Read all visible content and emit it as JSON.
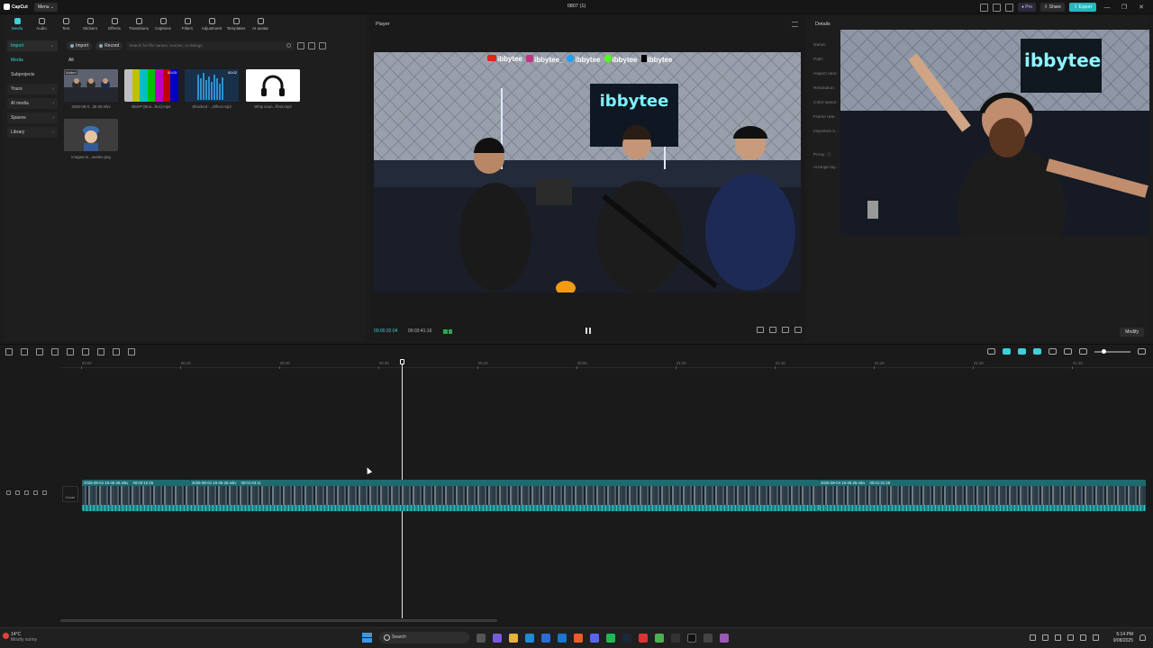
{
  "app": {
    "logo_label": "CapCut",
    "menu_label": "Menu",
    "doc_title": "0807 (1)",
    "pro_label": "Pro",
    "share_label": "Share",
    "export_label": "Export",
    "window_controls": [
      "—",
      "❐",
      "✕"
    ]
  },
  "media_tabs": [
    "Media",
    "Audio",
    "Text",
    "Stickers",
    "Effects",
    "Transitions",
    "Captions",
    "Filters",
    "Adjustment",
    "Templates",
    "AI avatar"
  ],
  "sidebar": [
    {
      "label": "Import",
      "state": "active",
      "chevron": "⌄"
    },
    {
      "label": "Media",
      "state": "sub-active",
      "chevron": ""
    },
    {
      "label": "Subprojects",
      "state": "",
      "chevron": ""
    },
    {
      "label": "Yours",
      "state": "boxed",
      "chevron": "›"
    },
    {
      "label": "AI media",
      "state": "boxed",
      "chevron": "›"
    },
    {
      "label": "Spaces",
      "state": "boxed",
      "chevron": "›"
    },
    {
      "label": "Library",
      "state": "boxed",
      "chevron": "›"
    }
  ],
  "media_toolbar": {
    "import_label": "Import",
    "record_label": "Record",
    "search_placeholder": "Search for file names, scenes, or dialogs"
  },
  "media": {
    "filter_label": "All",
    "items": [
      {
        "caption": "2025-08-0...35-28.mkv",
        "tag": "Added",
        "duration": ""
      },
      {
        "caption": "BEEP (Bea...fect).mp4",
        "tag": "",
        "duration": "00:03"
      },
      {
        "caption": "Shocked -...Effect.mp3",
        "tag": "",
        "duration": "00:02"
      },
      {
        "caption": "Whip soun...ffect.mp3",
        "tag": "",
        "duration": ""
      },
      {
        "caption": "images-re...aveles.png",
        "tag": "",
        "duration": ""
      }
    ]
  },
  "player": {
    "title": "Player",
    "overlay_handles": [
      "ibbytee",
      "ibbytee_",
      "ibbytee",
      "ibbytee",
      "ibbytee"
    ],
    "neon_sign": "ibbytee",
    "current_time": "00:00:32:04",
    "total_time": "00:03:41:16"
  },
  "details": {
    "title": "Details",
    "rows": [
      "Name:",
      "Path:",
      "Aspect ratio:",
      "Resolution:",
      "Color space:",
      "Frame rate:",
      "Imported m...",
      "Proxy: ⓘ",
      "Arrange lay..."
    ],
    "cam_neon_sign": "ibbytee",
    "modify_label": "Modify"
  },
  "timeline": {
    "ruler_ticks": [
      "00:00",
      "00:10",
      "00:20",
      "00:30",
      "00:40",
      "00:50",
      "01:00",
      "01:10",
      "01:20",
      "01:30",
      "01:40"
    ],
    "cover_label": "Cover",
    "clips": [
      {
        "name": "2025-08-04 19-35-28.mkv",
        "duration": "00:00:10:26"
      },
      {
        "name": "2025-08-04 19-35-28.mkv",
        "duration": "00:01:03:11"
      },
      {
        "name": "2025-08-04 19-35-28.mkv",
        "duration": "00:01:31:28"
      }
    ]
  },
  "taskbar": {
    "temp": "14°C",
    "weather": "Mostly sunny",
    "search_label": "Search",
    "time": "5:14 PM",
    "date": "9/08/2025"
  },
  "colors": {
    "accent": "#3bd1d8",
    "export": "#22b8c0",
    "clip": "#1f7a7e"
  }
}
